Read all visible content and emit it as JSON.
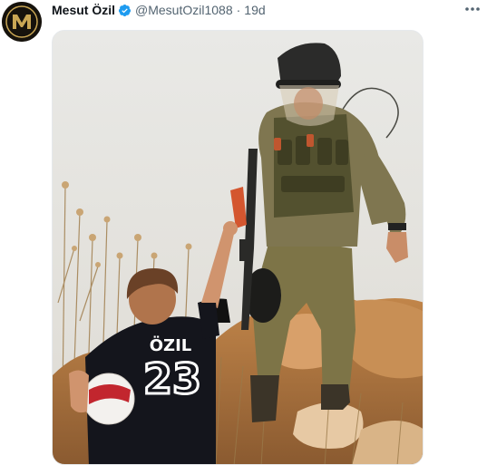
{
  "tweet": {
    "author": {
      "display_name": "Mesut Özil",
      "handle": "@MesutOzil1088",
      "verified": true,
      "avatar_icon": "m10-logo-icon"
    },
    "separator": "·",
    "timestamp": "19d",
    "more_icon": "more-horizontal-icon",
    "media": {
      "jersey_name": "ÖZIL",
      "jersey_number": "23"
    }
  },
  "colors": {
    "verified": "#1d9bf0",
    "secondary_text": "#536471",
    "avatar_bg": "#16120c",
    "avatar_gold": "#c9a654"
  }
}
